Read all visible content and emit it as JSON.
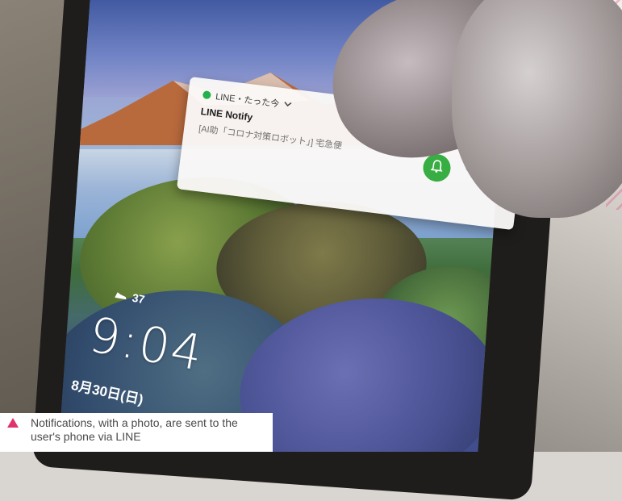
{
  "notification": {
    "app_header": "LINE・たった今",
    "title": "LINE Notify",
    "body": "[AI助「コロナ対策ロボット」] 宅急便"
  },
  "lockscreen": {
    "steps": "37",
    "time": "9:04",
    "date": "8月30日(日)"
  },
  "caption": {
    "text": "Notifications, with a photo, are sent to the user's phone via LINE",
    "marker_color": "#e0336e"
  },
  "colors": {
    "bell_button": "#37ad42",
    "line_brand": "#22b14c"
  }
}
